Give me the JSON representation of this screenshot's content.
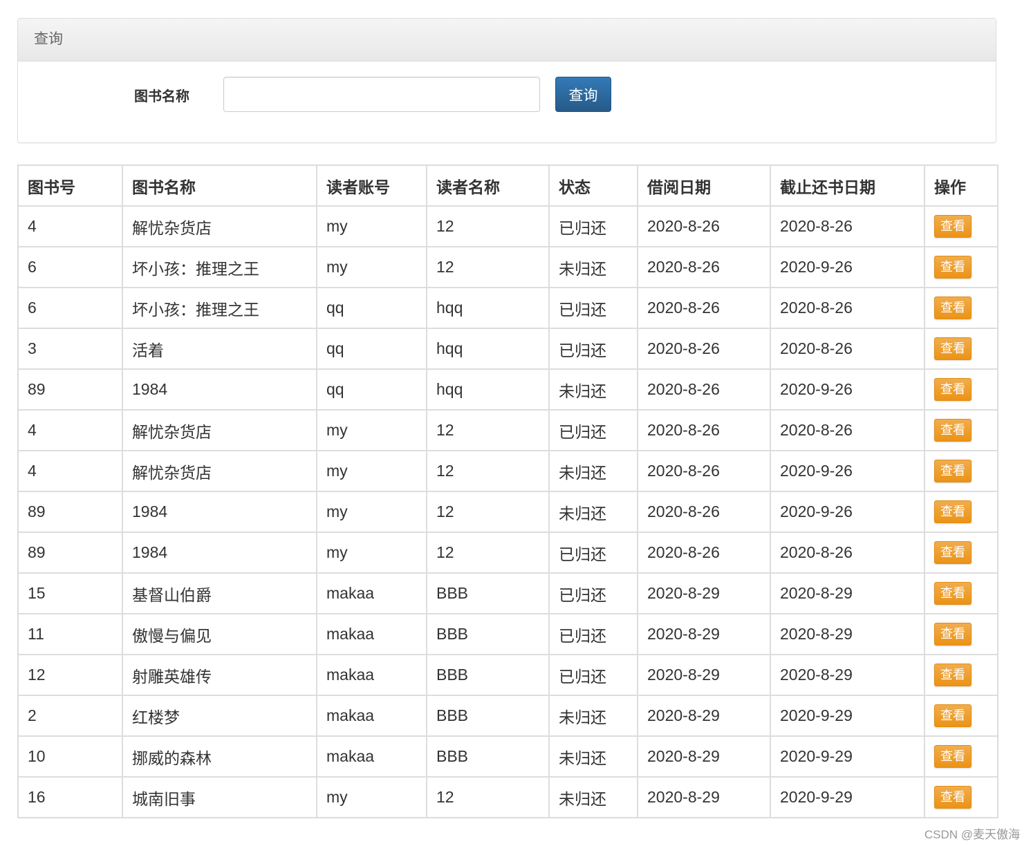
{
  "panel": {
    "title": "查询"
  },
  "search": {
    "label": "图书名称",
    "value": "",
    "placeholder": "",
    "button": "查询"
  },
  "table": {
    "headers": [
      "图书号",
      "图书名称",
      "读者账号",
      "读者名称",
      "状态",
      "借阅日期",
      "截止还书日期",
      "操作"
    ],
    "action_label": "查看",
    "rows": [
      [
        "4",
        "解忧杂货店",
        "my",
        "12",
        "已归还",
        "2020-8-26",
        "2020-8-26"
      ],
      [
        "6",
        "坏小孩：推理之王",
        "my",
        "12",
        "未归还",
        "2020-8-26",
        "2020-9-26"
      ],
      [
        "6",
        "坏小孩：推理之王",
        "qq",
        "hqq",
        "已归还",
        "2020-8-26",
        "2020-8-26"
      ],
      [
        "3",
        "活着",
        "qq",
        "hqq",
        "已归还",
        "2020-8-26",
        "2020-8-26"
      ],
      [
        "89",
        "1984",
        "qq",
        "hqq",
        "未归还",
        "2020-8-26",
        "2020-9-26"
      ],
      [
        "4",
        "解忧杂货店",
        "my",
        "12",
        "已归还",
        "2020-8-26",
        "2020-8-26"
      ],
      [
        "4",
        "解忧杂货店",
        "my",
        "12",
        "未归还",
        "2020-8-26",
        "2020-9-26"
      ],
      [
        "89",
        "1984",
        "my",
        "12",
        "未归还",
        "2020-8-26",
        "2020-9-26"
      ],
      [
        "89",
        "1984",
        "my",
        "12",
        "已归还",
        "2020-8-26",
        "2020-8-26"
      ],
      [
        "15",
        "基督山伯爵",
        "makaa",
        "BBB",
        "已归还",
        "2020-8-29",
        "2020-8-29"
      ],
      [
        "11",
        "傲慢与偏见",
        "makaa",
        "BBB",
        "已归还",
        "2020-8-29",
        "2020-8-29"
      ],
      [
        "12",
        "射雕英雄传",
        "makaa",
        "BBB",
        "已归还",
        "2020-8-29",
        "2020-8-29"
      ],
      [
        "2",
        "红楼梦",
        "makaa",
        "BBB",
        "未归还",
        "2020-8-29",
        "2020-9-29"
      ],
      [
        "10",
        "挪威的森林",
        "makaa",
        "BBB",
        "未归还",
        "2020-8-29",
        "2020-9-29"
      ],
      [
        "16",
        "城南旧事",
        "my",
        "12",
        "未归还",
        "2020-8-29",
        "2020-9-29"
      ]
    ]
  },
  "watermark": "CSDN @麦天傲海",
  "colors": {
    "primary": "#337ab7",
    "warning": "#f0ad4e",
    "border": "#dddddd"
  }
}
